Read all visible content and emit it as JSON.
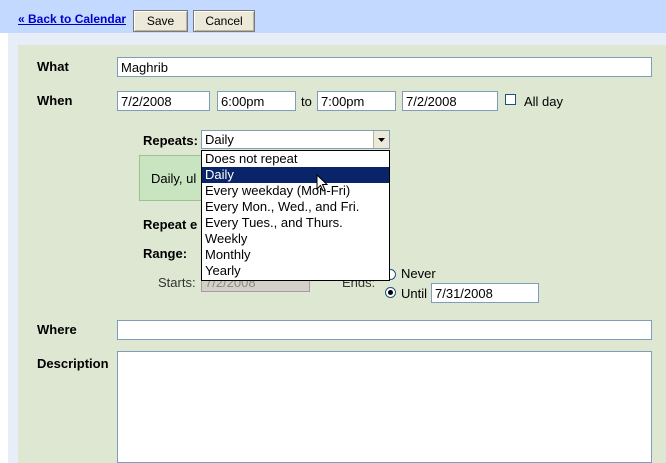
{
  "toolbar": {
    "back_link": "« Back to Calendar",
    "save_label": "Save",
    "cancel_label": "Cancel"
  },
  "form": {
    "what_label": "What",
    "what_value": "Maghrib",
    "when_label": "When",
    "start_date": "7/2/2008",
    "start_time": "6:00pm",
    "to_label": "to",
    "end_time": "7:00pm",
    "end_date": "7/2/2008",
    "all_day_label": "All day",
    "all_day_checked": false,
    "repeats_label": "Repeats:",
    "repeats_value": "Daily",
    "repeats_options": [
      "Does not repeat",
      "Daily",
      "Every weekday (Mon-Fri)",
      "Every Mon., Wed., and Fri.",
      "Every Tues., and Thurs.",
      "Weekly",
      "Monthly",
      "Yearly"
    ],
    "summary_text": "Daily, ul",
    "repeat_every_label": "Repeat e",
    "range_label": "Range:",
    "starts_label": "Starts:",
    "starts_value": "7/2/2008",
    "ends_label": "Ends:",
    "never_label": "Never",
    "until_label": "Until",
    "until_value": "7/31/2008",
    "where_label": "Where",
    "where_value": "",
    "description_label": "Description",
    "description_value": ""
  },
  "colors": {
    "topbar": "#c3d9ff",
    "form_bg": "#dde7d1",
    "summary_bg": "#c8e4c0",
    "selected_option": "#0a246a"
  }
}
